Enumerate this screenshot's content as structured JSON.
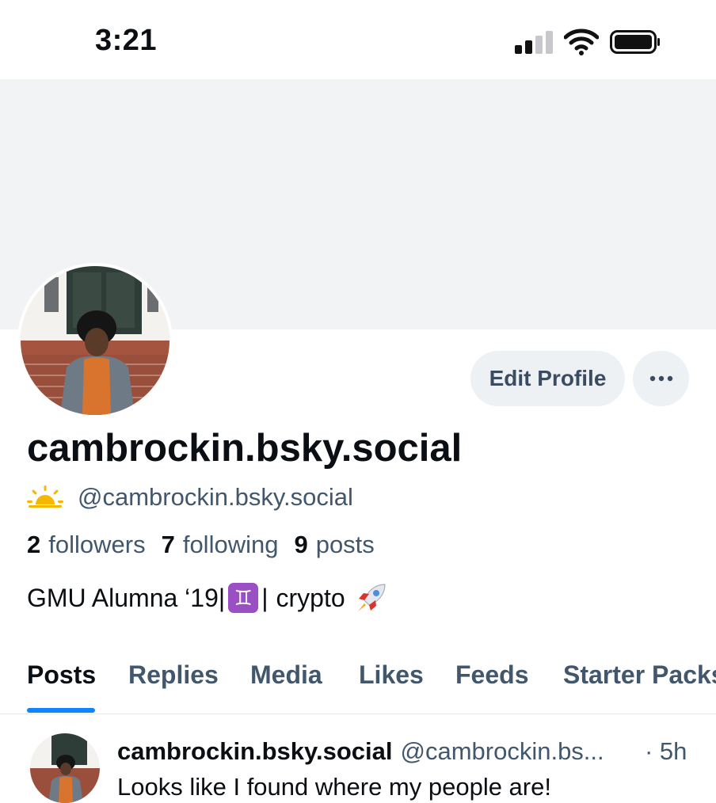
{
  "status_bar": {
    "time": "3:21"
  },
  "profile": {
    "display_name": "cambrockin.bsky.social",
    "handle": "@cambrockin.bsky.social",
    "followers_count": "2",
    "followers_label": "followers",
    "following_count": "7",
    "following_label": "following",
    "posts_count": "9",
    "posts_label": "posts",
    "bio_part1": "GMU Alumna ‘19",
    "bio_separator": "|",
    "bio_part2": "crypto",
    "bio_gemini_glyph": "♊"
  },
  "actions": {
    "edit_profile": "Edit Profile"
  },
  "tabs": [
    {
      "label": "Posts",
      "active": true
    },
    {
      "label": "Replies"
    },
    {
      "label": "Media"
    },
    {
      "label": "Likes"
    },
    {
      "label": "Feeds"
    },
    {
      "label": "Starter Packs"
    }
  ],
  "post": {
    "author": "cambrockin.bsky.social",
    "handle": "@cambrockin.bs...",
    "time": "· 5h",
    "text": "Looks like I found where my people are!"
  },
  "icons": [
    "signal-icon",
    "wifi-icon",
    "battery-icon",
    "more-icon",
    "sunrise-icon",
    "gemini-icon",
    "rocket-icon"
  ],
  "colors": {
    "accent": "#1083fe",
    "muted_text": "#42576c",
    "button_bg": "#eef1f4",
    "banner": "#f1f3f5"
  }
}
